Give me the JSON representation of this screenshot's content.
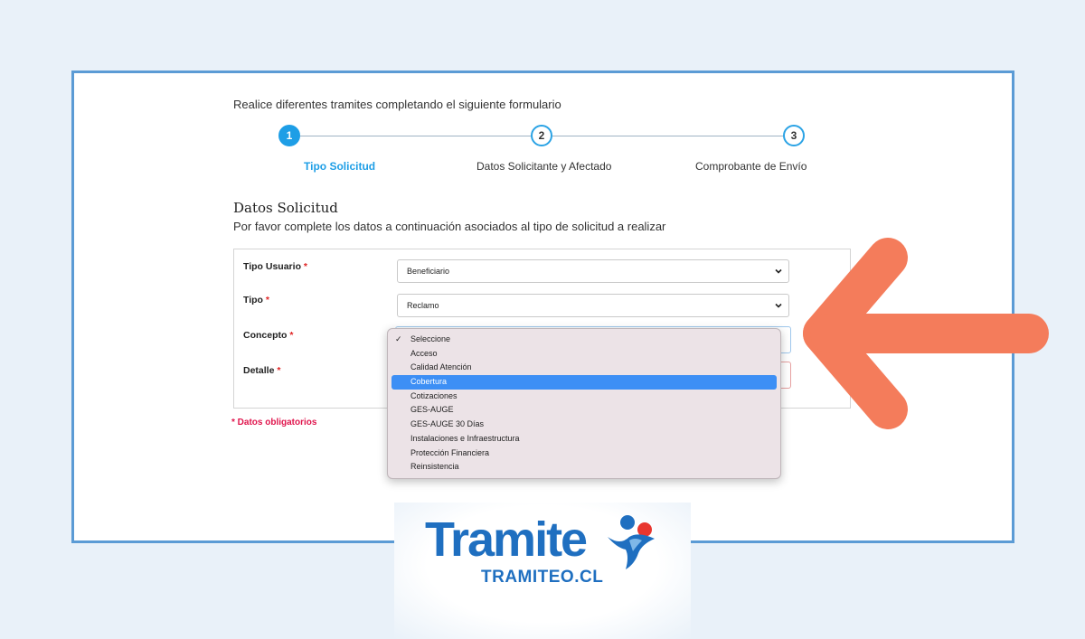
{
  "intro_text": "Realice diferentes tramites completando el siguiente formulario",
  "steps": [
    {
      "number": "1",
      "label": "Tipo Solicitud",
      "state": "active"
    },
    {
      "number": "2",
      "label": "Datos Solicitante y Afectado",
      "state": "idle"
    },
    {
      "number": "3",
      "label": "Comprobante de Envío",
      "state": "idle"
    }
  ],
  "section": {
    "title": "Datos Solicitud",
    "subtitle": "Por favor complete los datos a continuación asociados al tipo de solicitud a realizar"
  },
  "form": {
    "required_marker": "*",
    "tipo_usuario": {
      "label": "Tipo Usuario",
      "value": "Beneficiario"
    },
    "tipo": {
      "label": "Tipo",
      "value": "Reclamo"
    },
    "concepto": {
      "label": "Concepto"
    },
    "detalle": {
      "label": "Detalle"
    },
    "mandatory_note": "* Datos obligatorios"
  },
  "concepto_dropdown": {
    "checkmark": "✓",
    "checked_option": "Seleccione",
    "highlighted_option": "Cobertura",
    "options": [
      "Seleccione",
      "Acceso",
      "Calidad Atención",
      "Cobertura",
      "Cotizaciones",
      "GES-AUGE",
      "GES-AUGE 30 Días",
      "Instalaciones e Infraestructura",
      "Protección Financiera",
      "Reinsistencia"
    ]
  },
  "logo": {
    "brand": "Tramiteo",
    "domain": "TRAMITEO.CL"
  },
  "colors": {
    "accent": "#1e9ee6",
    "frame_border": "#5b9bd5",
    "arrow": "#f47c5b",
    "highlight": "#3d8ff5",
    "required": "#e02424",
    "brand_blue": "#1f6fc0",
    "brand_red": "#e8362f"
  },
  "icons": {
    "select_chevron": "chevron-down-icon",
    "pointer_arrow": "left-arrow-icon",
    "logo_figure": "people-figure-icon"
  }
}
